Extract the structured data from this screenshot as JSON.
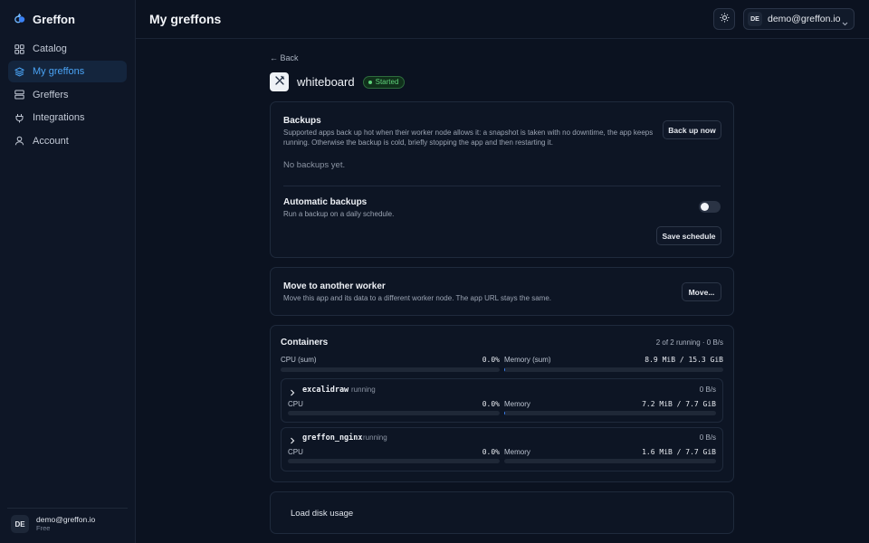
{
  "brand": {
    "name": "Greffon",
    "accent": "#4aa3f5"
  },
  "sidebar": {
    "items": [
      {
        "label": "Catalog",
        "icon": "grid-icon",
        "active": false
      },
      {
        "label": "My greffons",
        "icon": "layers-icon",
        "active": true
      },
      {
        "label": "Greffers",
        "icon": "server-icon",
        "active": false
      },
      {
        "label": "Integrations",
        "icon": "plug-icon",
        "active": false
      },
      {
        "label": "Account",
        "icon": "user-icon",
        "active": false
      }
    ],
    "user": {
      "initials": "DE",
      "email": "demo@greffon.io",
      "plan": "Free"
    }
  },
  "header": {
    "title": "My greffons",
    "theme_icon": "sun-icon",
    "account": {
      "initials": "DE",
      "email": "demo@greffon.io"
    }
  },
  "app": {
    "back_label": "← Back",
    "name": "whiteboard",
    "status": "Started",
    "status_color": "#5fd27a"
  },
  "backups": {
    "title": "Backups",
    "description": "Supported apps back up hot when their worker node allows it: a snapshot is taken with no downtime, the app keeps running. Otherwise the backup is cold, briefly stopping the app and then restarting it.",
    "button": "Back up now",
    "empty": "No backups yet.",
    "auto_title": "Automatic backups",
    "auto_desc": "Run a backup on a daily schedule.",
    "auto_enabled": false,
    "save_button": "Save schedule"
  },
  "move": {
    "title": "Move to another worker",
    "description": "Move this app and its data to a different worker node. The app URL stays the same.",
    "button": "Move..."
  },
  "containers": {
    "title": "Containers",
    "summary": "2 of 2 running · 0 B/s",
    "cpu_label": "CPU (sum)",
    "cpu_value": "0.0%",
    "cpu_fraction": 0.0,
    "mem_label": "Memory (sum)",
    "mem_value": "8.9 MiB / 15.3 GiB",
    "mem_fraction": 0.0006,
    "items": [
      {
        "name": "excalidraw",
        "state": "running",
        "rate": "0 B/s",
        "cpu_label": "CPU",
        "cpu_value": "0.0%",
        "cpu_fraction": 0.0,
        "mem_label": "Memory",
        "mem_value": "7.2 MiB / 7.7 GiB",
        "mem_fraction": 0.0009
      },
      {
        "name": "greffon_nginx",
        "state": "running",
        "rate": "0 B/s",
        "cpu_label": "CPU",
        "cpu_value": "0.0%",
        "cpu_fraction": 0.0,
        "mem_label": "Memory",
        "mem_value": "1.6 MiB / 7.7 GiB",
        "mem_fraction": 0.0002
      }
    ]
  },
  "disk": {
    "button": "Load disk usage"
  }
}
